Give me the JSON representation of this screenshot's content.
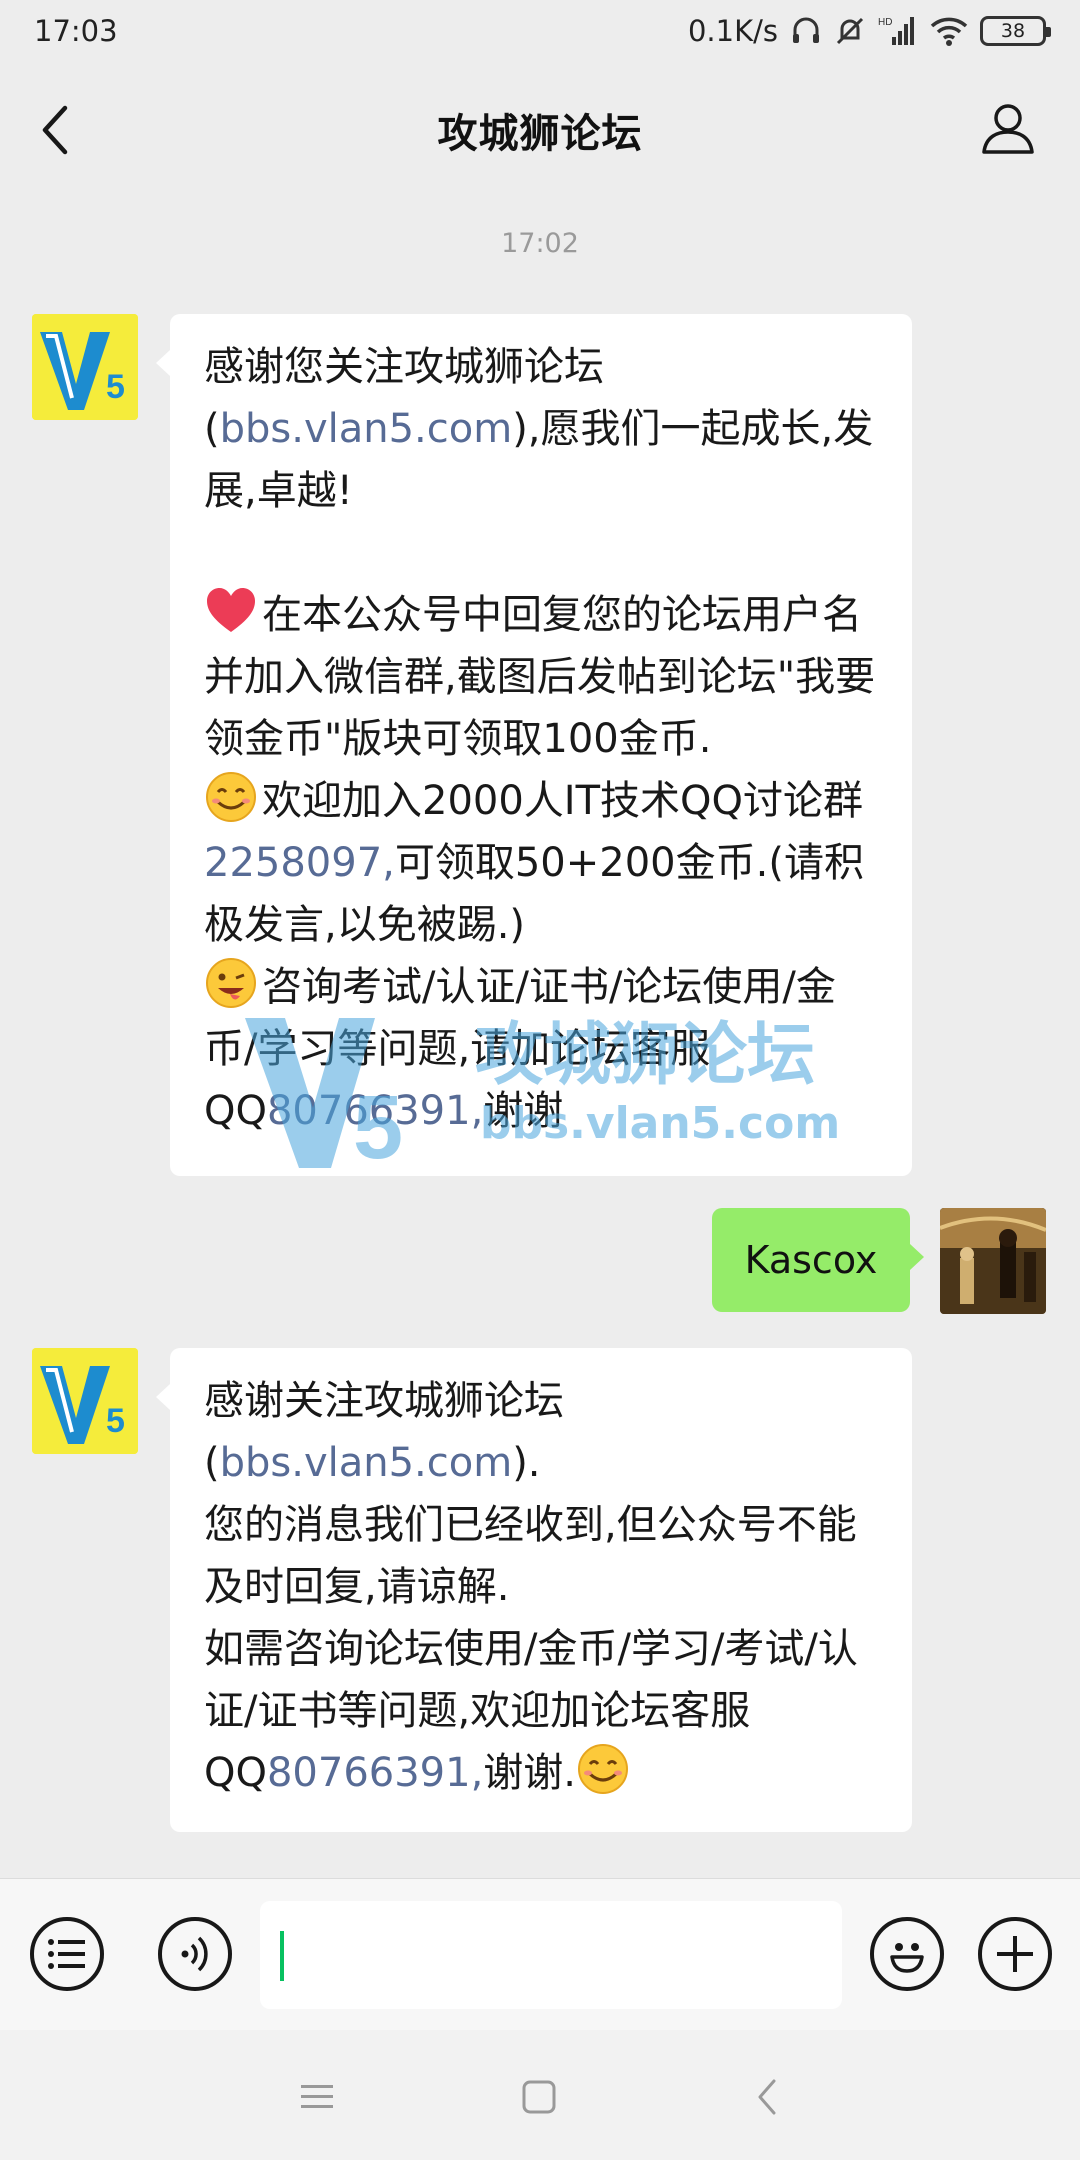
{
  "status_bar": {
    "time": "17:03",
    "network_speed": "0.1K/s",
    "network_type": "HD",
    "battery": "38",
    "icons": [
      "headphones-icon",
      "mute-bell-icon",
      "signal-icon",
      "wifi-icon",
      "battery-icon"
    ]
  },
  "header": {
    "title": "攻城狮论坛",
    "back_icon": "chevron-left-icon",
    "profile_icon": "person-icon"
  },
  "chat": {
    "timestamp": "17:02",
    "message1": {
      "sender": "official",
      "avatar_text": "V5",
      "line1_pre": "感谢您关注攻城狮论坛(",
      "line1_link": "bbs.vlan5.com",
      "line1_post": "),愿我们一起成长,发展,卓越!",
      "line2": "在本公众号中回复您的论坛用户名并加入微信群,截图后发帖到论坛\"我要领金币\"版块可领取100金币.",
      "line3_pre": "欢迎加入2000人IT技术QQ讨论群",
      "line3_link": "2258097,",
      "line3_post": "可领取50+200金币.(请积极发言,以免被踢.)",
      "line4_pre": "咨询考试/认证/证书/论坛使用/金币/学习等问题,请加论坛客服QQ",
      "line4_link": "80766391,",
      "line4_post": "谢谢"
    },
    "message2": {
      "sender": "me",
      "text": "Kascox"
    },
    "message3": {
      "sender": "official",
      "avatar_text": "V5",
      "line1_pre": "感谢关注攻城狮论坛(",
      "line1_link": "bbs.vlan5.com",
      "line1_post": ").",
      "line2": "您的消息我们已经收到,但公众号不能及时回复,请谅解.",
      "line3_pre": "如需咨询论坛使用/金币/学习/考试/认证/证书等问题,欢迎加论坛客服QQ",
      "line3_link": "80766391,",
      "line3_post": "谢谢."
    },
    "watermark": {
      "title": "攻城狮论坛",
      "url": "bbs.vlan5.com"
    }
  },
  "input_bar": {
    "menu_icon": "menu-list-icon",
    "voice_icon": "voice-icon",
    "emoji_icon": "emoji-face-icon",
    "plus_icon": "plus-icon"
  },
  "nav_bar": {
    "icons": [
      "recents-icon",
      "home-icon",
      "back-icon"
    ]
  },
  "colors": {
    "background": "#ededed",
    "bubble_me": "#95ec69",
    "link": "#576b95",
    "avatar_bg": "#f5ec3b",
    "caret": "#07c160"
  }
}
